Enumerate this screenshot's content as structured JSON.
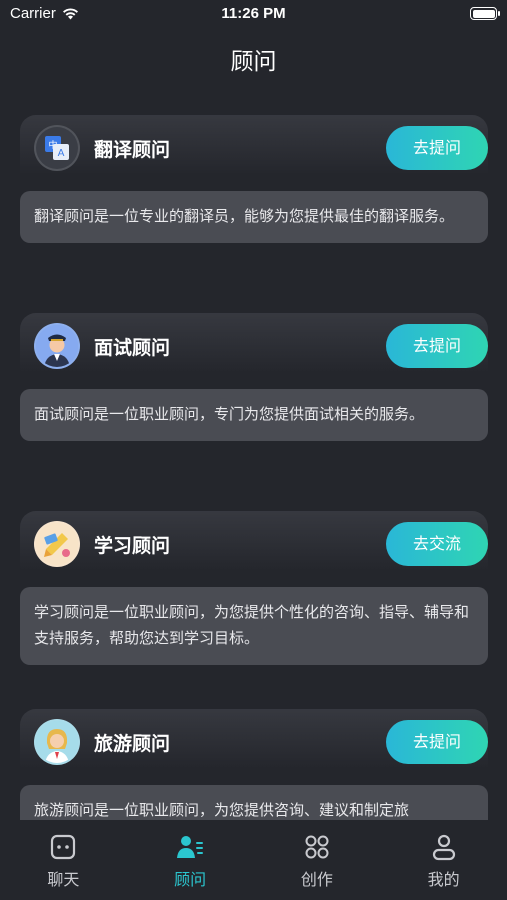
{
  "status_bar": {
    "carrier": "Carrier",
    "time": "11:26 PM"
  },
  "header": {
    "title": "顾问"
  },
  "advisors": [
    {
      "name": "翻译顾问",
      "button": "去提问",
      "description": "翻译顾问是一位专业的翻译员，能够为您提供最佳的翻译服务。",
      "icon": "translate-icon"
    },
    {
      "name": "面试顾问",
      "button": "去提问",
      "description": "面试顾问是一位职业顾问，专门为您提供面试相关的服务。",
      "icon": "interviewer-avatar"
    },
    {
      "name": "学习顾问",
      "button": "去交流",
      "description": "学习顾问是一位职业顾问，为您提供个性化的咨询、指导、辅导和支持服务，帮助您达到学习目标。",
      "icon": "study-avatar"
    },
    {
      "name": "旅游顾问",
      "button": "去提问",
      "description": "旅游顾问是一位职业顾问，为您提供咨询、建议和制定旅",
      "icon": "travel-avatar"
    }
  ],
  "tab_bar": {
    "active": "advisor",
    "items": [
      {
        "label": "聊天",
        "icon": "chat-icon"
      },
      {
        "label": "顾问",
        "icon": "advisor-icon"
      },
      {
        "label": "创作",
        "icon": "create-icon"
      },
      {
        "label": "我的",
        "icon": "profile-icon"
      }
    ]
  },
  "colors": {
    "background": "#24262c",
    "accent": "#2bc6cf",
    "button_gradient_start": "#2ab7d7",
    "button_gradient_end": "#2fd5b3",
    "card": "#4a4c53"
  }
}
